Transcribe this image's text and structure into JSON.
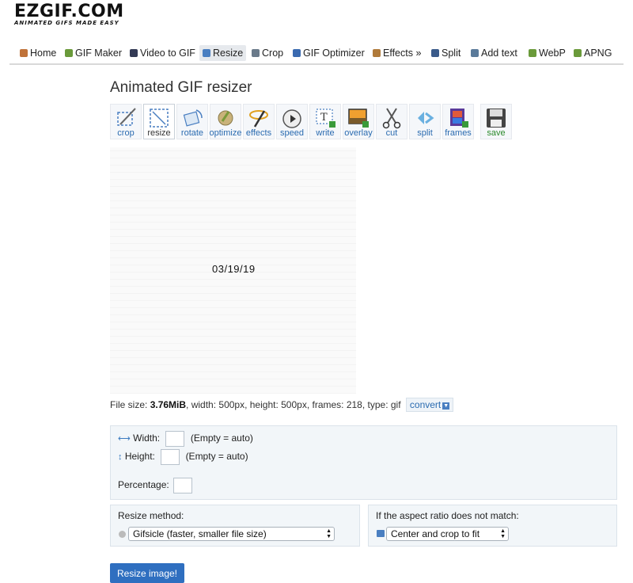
{
  "logo": {
    "name": "EZGIF.COM",
    "tagline": "ANIMATED GIFS MADE EASY"
  },
  "nav": [
    {
      "label": "Home",
      "icon": "home-icon",
      "color": "#c0733a"
    },
    {
      "label": "GIF Maker",
      "icon": "gif-maker-icon",
      "color": "#6a9a3a"
    },
    {
      "label": "Video to GIF",
      "icon": "film-icon",
      "color": "#333a55"
    },
    {
      "label": "Resize",
      "icon": "resize-icon",
      "color": "#4a7fc1"
    },
    {
      "label": "Crop",
      "icon": "crop-icon",
      "color": "#6a7a8a"
    },
    {
      "label": "GIF Optimizer",
      "icon": "optimizer-icon",
      "color": "#3a6ab0"
    },
    {
      "label": "Effects »",
      "icon": "effects-icon",
      "color": "#b07a3a"
    },
    {
      "label": "Split",
      "icon": "split-icon",
      "color": "#3a5a8a"
    },
    {
      "label": "Add text",
      "icon": "text-icon",
      "color": "#5a7a9a"
    },
    {
      "label": "WebP",
      "icon": "webp-icon",
      "color": "#6a9a3a"
    },
    {
      "label": "APNG",
      "icon": "apng-icon",
      "color": "#6a9a3a"
    }
  ],
  "page": {
    "title": "Animated GIF resizer"
  },
  "tools": [
    {
      "label": "crop",
      "icon": "crop-tool-icon"
    },
    {
      "label": "resize",
      "icon": "resize-tool-icon"
    },
    {
      "label": "rotate",
      "icon": "rotate-tool-icon"
    },
    {
      "label": "optimize",
      "icon": "optimize-tool-icon"
    },
    {
      "label": "effects",
      "icon": "effects-tool-icon"
    },
    {
      "label": "speed",
      "icon": "speed-tool-icon"
    },
    {
      "label": "write",
      "icon": "write-tool-icon"
    },
    {
      "label": "overlay",
      "icon": "overlay-tool-icon"
    },
    {
      "label": "cut",
      "icon": "scissors-icon"
    },
    {
      "label": "split",
      "icon": "split-tool-icon"
    },
    {
      "label": "frames",
      "icon": "frames-tool-icon"
    },
    {
      "label": "save",
      "icon": "floppy-disk-icon"
    }
  ],
  "preview": {
    "text": "03/19/19"
  },
  "fileinfo": {
    "size_label": "File size: ",
    "size": "3.76MiB",
    "rest": ", width: 500px, height: 500px, frames: 218, type: gif",
    "convert": "convert"
  },
  "form": {
    "width_label": "Width:",
    "height_label": "Height:",
    "empty_hint": "(Empty = auto)",
    "percentage_label": "Percentage:",
    "width_value": "",
    "height_value": "",
    "percentage_value": "",
    "method_label": "Resize method:",
    "method_value": "Gifsicle (faster, smaller file size)",
    "aspect_label": "If the aspect ratio does not match:",
    "aspect_value": "Center and crop to fit",
    "submit": "Resize image!"
  }
}
